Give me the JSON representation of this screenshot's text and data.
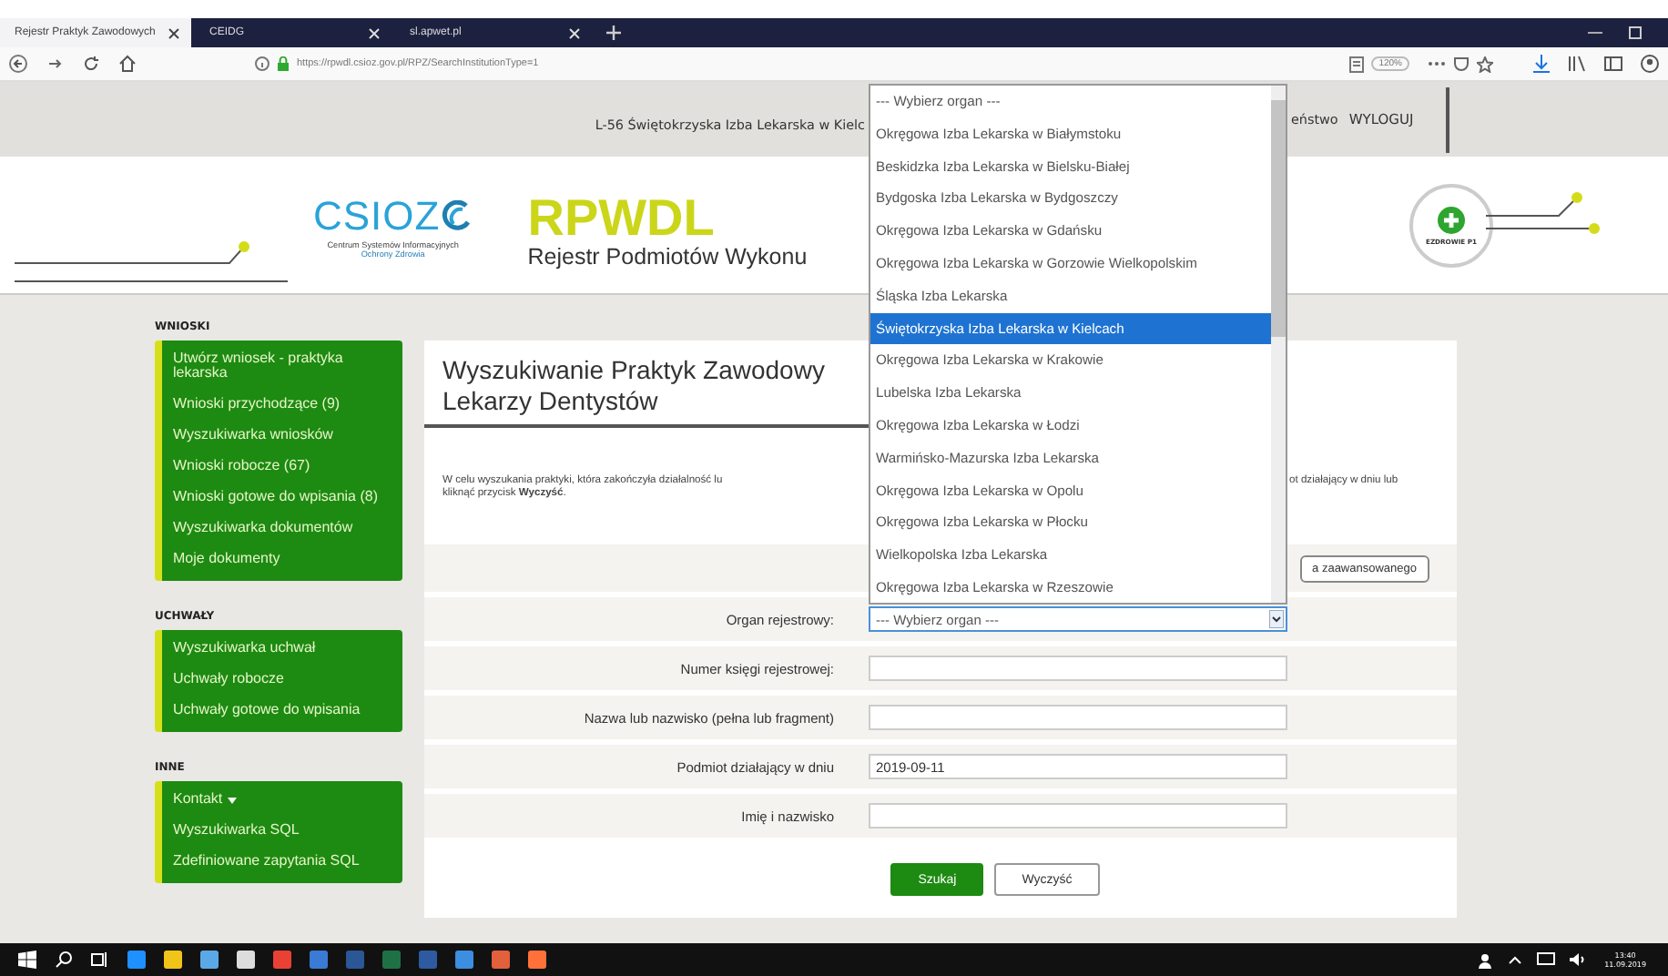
{
  "browser": {
    "tabs": [
      {
        "label": "Rejestr Praktyk Zawodowych",
        "selected": true
      },
      {
        "label": "CEIDG",
        "selected": false
      },
      {
        "label": "sl.apwet.pl",
        "selected": false
      }
    ],
    "url": "https://rpwdl.csioz.gov.pl/RPZ/SearchInstitutionType=1",
    "zoom": "120%"
  },
  "header": {
    "user": "L-56 Świętokrzyska Izba Lekarska w Kielc",
    "link_partial": "eństwo",
    "logout": "WYLOGUJ"
  },
  "logo": {
    "csioz": "CSIOZ",
    "caption_lines": [
      "Centrum Systemów Informacyjnych",
      "Ochrony Zdrowia"
    ],
    "app": "RPWDL",
    "app_subtitle": "Rejestr Podmiotów Wykonu",
    "badge": "EZDROWIE P1"
  },
  "sidebar": [
    {
      "heading": "WNIOSKI",
      "items": [
        "Utwórz wniosek - praktyka lekarska",
        "Wnioski przychodzące (9)",
        "Wyszukiwarka wniosków",
        "Wnioski robocze (67)",
        "Wnioski gotowe do wpisania (8)",
        "Wyszukiwarka dokumentów",
        "Moje dokumenty"
      ]
    },
    {
      "heading": "UCHWAŁY",
      "items": [
        "Wyszukiwarka uchwał",
        "Uchwały robocze",
        "Uchwały gotowe do wpisania"
      ]
    },
    {
      "heading": "INNE",
      "items": [
        "Kontakt",
        "Wyszukiwarka SQL",
        "Zdefiniowane zapytania SQL"
      ]
    }
  ],
  "main": {
    "title_lines": [
      "Wyszukiwanie Praktyk Zawodowy",
      "Lekarzy Dentystów"
    ],
    "description_left": "W celu wyszukania praktyki, która zakończyła działalność lu",
    "description_right": "ot działający w dniu lub",
    "description_line2": "kliknąć przycisk **Wyczyść**.",
    "advanced_button": "a zaawansowanego",
    "fields": [
      {
        "label": "Organ rejestrowy:",
        "kind": "select",
        "value": "--- Wybierz organ ---"
      },
      {
        "label": "Numer księgi rejestrowej:",
        "kind": "text"
      },
      {
        "label": "Nazwa lub nazwisko (pełna lub fragment)",
        "kind": "text"
      },
      {
        "label": "Podmiot działający w dniu",
        "kind": "text",
        "value": "2019-09-11"
      },
      {
        "label": "Imię i nazwisko",
        "kind": "text"
      }
    ],
    "buttons": [
      {
        "label": "Szukaj",
        "kind": "primary"
      },
      {
        "label": "Wyczyść",
        "kind": "secondary"
      }
    ]
  },
  "dropdown": {
    "options": [
      {
        "label": "--- Wybierz organ ---",
        "selected": false
      },
      {
        "label": "Okręgowa Izba Lekarska w Białymstoku",
        "selected": false
      },
      {
        "label": "Beskidzka Izba Lekarska w Bielsku-Białej",
        "selected": false
      },
      {
        "label": "Bydgoska Izba Lekarska w Bydgoszczy",
        "selected": false
      },
      {
        "label": "Okręgowa Izba Lekarska w Gdańsku",
        "selected": false
      },
      {
        "label": "Okręgowa Izba Lekarska w Gorzowie Wielkopolskim",
        "selected": false
      },
      {
        "label": "Śląska Izba Lekarska",
        "selected": false
      },
      {
        "label": "Świętokrzyska Izba Lekarska w Kielcach",
        "selected": true
      },
      {
        "label": "Okręgowa Izba Lekarska w Krakowie",
        "selected": false
      },
      {
        "label": "Lubelska Izba Lekarska",
        "selected": false
      },
      {
        "label": "Okręgowa Izba Lekarska w Łodzi",
        "selected": false
      },
      {
        "label": "Warmińsko-Mazurska Izba Lekarska",
        "selected": false
      },
      {
        "label": "Okręgowa Izba Lekarska w Opolu",
        "selected": false
      },
      {
        "label": "Okręgowa Izba Lekarska w Płocku",
        "selected": false
      },
      {
        "label": "Wielkopolska Izba Lekarska",
        "selected": false
      },
      {
        "label": "Okręgowa Izba Lekarska w Rzeszowie",
        "selected": false
      }
    ]
  },
  "taskbar": {
    "time": "13:40",
    "date": "11.09.2019"
  }
}
